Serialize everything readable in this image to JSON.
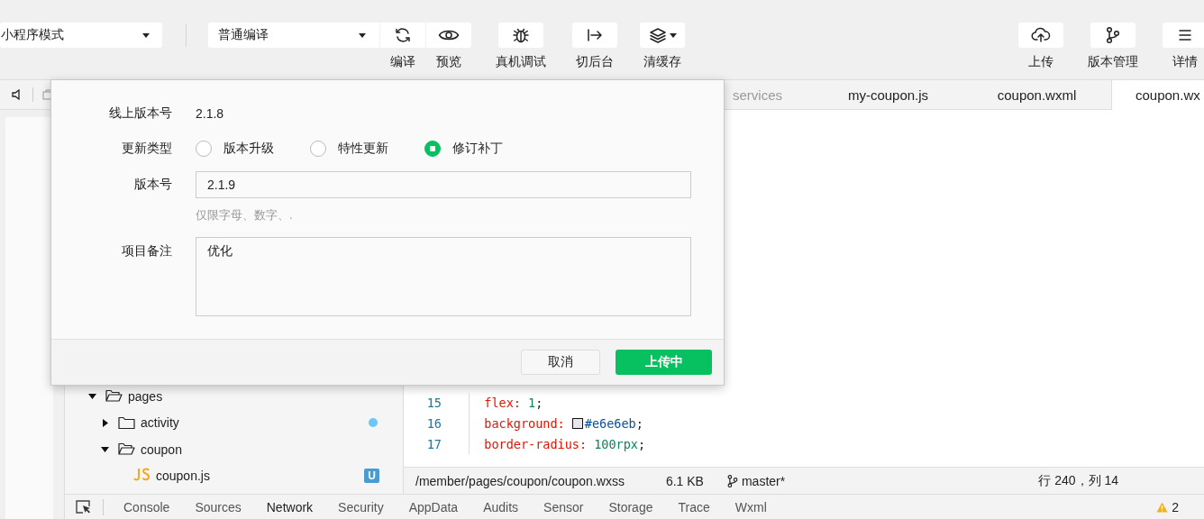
{
  "toolbar": {
    "mode_select": {
      "value": "小程序模式"
    },
    "compile_select": {
      "value": "普通编译"
    },
    "buttons": [
      {
        "label": "编译",
        "kind": "refresh"
      },
      {
        "label": "预览",
        "kind": "eye"
      },
      {
        "label": "真机调试",
        "kind": "bug"
      },
      {
        "label": "切后台",
        "kind": "switch"
      },
      {
        "label": "清缓存",
        "kind": "layers"
      }
    ],
    "right_buttons": [
      {
        "label": "上传",
        "kind": "cloud"
      },
      {
        "label": "版本管理",
        "kind": "branch"
      },
      {
        "label": "详情",
        "kind": "menu"
      }
    ]
  },
  "file_tree": [
    {
      "name": "pages",
      "kind": "folder",
      "expanded": true,
      "children": [
        {
          "name": "activity",
          "kind": "folder",
          "expanded": false,
          "color": "#6ec6f5"
        },
        {
          "name": "coupon",
          "kind": "folder",
          "expanded": true,
          "children": [
            {
              "name": "coupon.js",
              "kind": "js",
              "badge": "U"
            }
          ]
        }
      ]
    }
  ],
  "editor": {
    "tabs": [
      {
        "label": "services",
        "selected": false
      },
      {
        "label": "my-coupon.js",
        "selected": false
      },
      {
        "label": "coupon.wxml",
        "selected": false
      },
      {
        "label": "coupon.wx",
        "selected": true
      }
    ],
    "lines": [
      {
        "number": "15",
        "tokens": [
          {
            "kind": "prop",
            "text": "  flex: "
          },
          {
            "kind": "num",
            "text": "1"
          },
          {
            "kind": "punct",
            "text": ";"
          }
        ]
      },
      {
        "number": "16",
        "tokens": [
          {
            "kind": "prop",
            "text": "  background: "
          },
          {
            "kind": "swatch",
            "color": "#e6e6eb"
          },
          {
            "kind": "hex",
            "text": "#e6e6eb"
          },
          {
            "kind": "punct",
            "text": ";"
          }
        ]
      },
      {
        "number": "17",
        "tokens": [
          {
            "kind": "prop",
            "text": "  border-radius: "
          },
          {
            "kind": "num",
            "text": "100rpx"
          },
          {
            "kind": "punct",
            "text": ";"
          }
        ]
      }
    ],
    "status_bar": {
      "path": "/member/pages/coupon/coupon.wxss",
      "size": "6.1 KB",
      "branch": "master*",
      "position": "行 240，列 14"
    }
  },
  "devtools": {
    "tabs": [
      {
        "label": "Console",
        "selected": false
      },
      {
        "label": "Sources",
        "selected": false
      },
      {
        "label": "Network",
        "selected": true
      },
      {
        "label": "Security",
        "selected": false
      },
      {
        "label": "AppData",
        "selected": false
      },
      {
        "label": "Audits",
        "selected": false
      },
      {
        "label": "Sensor",
        "selected": false
      },
      {
        "label": "Storage",
        "selected": false
      },
      {
        "label": "Trace",
        "selected": false
      },
      {
        "label": "Wxml",
        "selected": false
      }
    ],
    "warnings": "2"
  },
  "upload_dialog": {
    "online_version_label": "线上版本号",
    "online_version": "2.1.8",
    "update_type_label": "更新类型",
    "update_types": [
      {
        "label": "版本升级",
        "selected": false
      },
      {
        "label": "特性更新",
        "selected": false
      },
      {
        "label": "修订补丁",
        "selected": true
      }
    ],
    "version_label": "版本号",
    "version_value": "2.1.9",
    "version_hint": "仅限字母、数字、.",
    "note_label": "项目备注",
    "note_value": "优化",
    "buttons": [
      {
        "label": "取消",
        "kind": "secondary"
      },
      {
        "label": "上传中",
        "kind": "primary"
      }
    ]
  }
}
